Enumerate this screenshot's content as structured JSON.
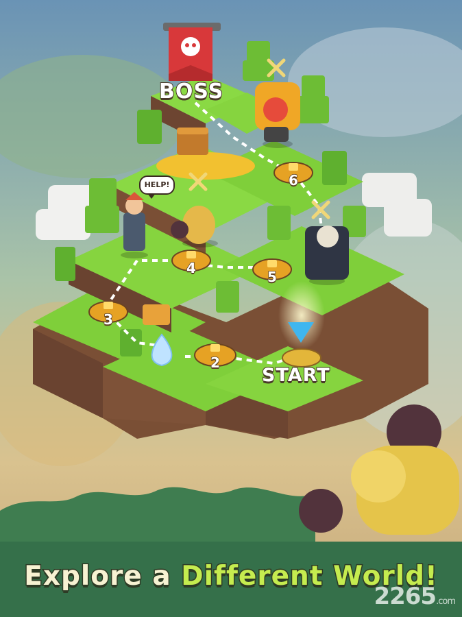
{
  "screen": {
    "boss_label": "BOSS",
    "start_label": "START",
    "help_bubble": "HELP!",
    "tagline_part1": "Explore a ",
    "tagline_part2": "Different World!",
    "watermark": "2265",
    "watermark_suffix": ".com"
  },
  "level_nodes": [
    {
      "level": "2",
      "locked": true
    },
    {
      "level": "3",
      "locked": true
    },
    {
      "level": "4",
      "locked": true
    },
    {
      "level": "5",
      "locked": true
    },
    {
      "level": "6",
      "locked": true
    }
  ],
  "colors": {
    "grass": "#7fcf3a",
    "dirt": "#7a4f35",
    "node_gold": "#e6a224",
    "tagline_light": "#f7f2d2",
    "tagline_green": "#c5ec4f",
    "banner_red": "#d8383a"
  }
}
